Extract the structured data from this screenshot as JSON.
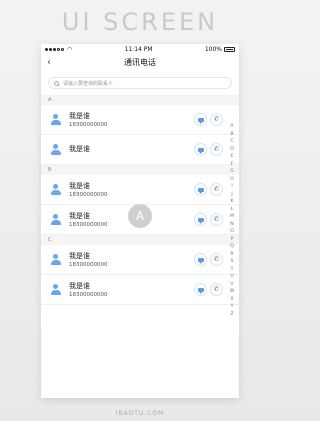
{
  "banner": "UI SCREEN",
  "status_bar": {
    "time": "11:14 PM",
    "battery": "100%"
  },
  "header": {
    "back_icon": "back-arrow",
    "title": "通讯电话"
  },
  "search": {
    "placeholder": "请输入要查询的联系人"
  },
  "sections": [
    {
      "label": "A",
      "contacts": [
        {
          "name": "我是谁",
          "phone": "18300000000"
        },
        {
          "name": "我是谁",
          "phone": ""
        }
      ]
    },
    {
      "label": "B",
      "contacts": [
        {
          "name": "我是谁",
          "phone": "18300000000"
        },
        {
          "name": "我是谁",
          "phone": "18300000000"
        }
      ]
    },
    {
      "label": "C",
      "contacts": [
        {
          "name": "我是谁",
          "phone": "18300000000"
        },
        {
          "name": "我是谁",
          "phone": "18300000000"
        }
      ]
    }
  ],
  "index_letters": [
    "A",
    "B",
    "C",
    "D",
    "E",
    "F",
    "G",
    "H",
    "I",
    "J",
    "K",
    "L",
    "M",
    "N",
    "O",
    "P",
    "Q",
    "R",
    "S",
    "T",
    "U",
    "V",
    "W",
    "X",
    "Y",
    "Z"
  ],
  "overlay_letter": "A",
  "footer": "IBAOTU.COM",
  "colors": {
    "accent": "#5b9be6",
    "avatar": "#6aa6ee"
  }
}
